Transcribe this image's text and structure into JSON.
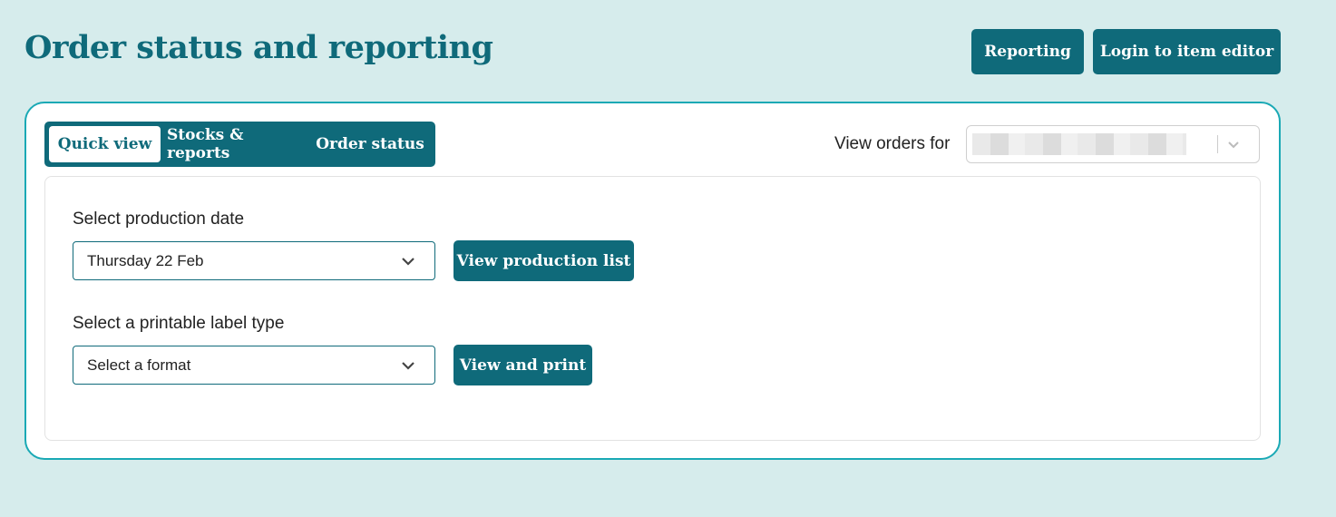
{
  "header": {
    "title": "Order status and reporting",
    "reporting_label": "Reporting",
    "login_label": "Login to item editor"
  },
  "tabs": [
    {
      "label": "Quick view",
      "active": true
    },
    {
      "label": "Stocks & reports",
      "active": false
    },
    {
      "label": "Order status",
      "active": false
    }
  ],
  "orders_filter": {
    "label": "View orders for",
    "value": ""
  },
  "production": {
    "label": "Select production date",
    "selected": "Thursday 22 Feb",
    "button_label": "View production list"
  },
  "labels": {
    "label": "Select a printable label type",
    "selected": "Select a format",
    "button_label": "View and print"
  },
  "colors": {
    "background": "#d6ecec",
    "primary": "#0f6a7a",
    "card_border": "#1aa9b5"
  },
  "icons": [
    "chevron-down-icon"
  ]
}
